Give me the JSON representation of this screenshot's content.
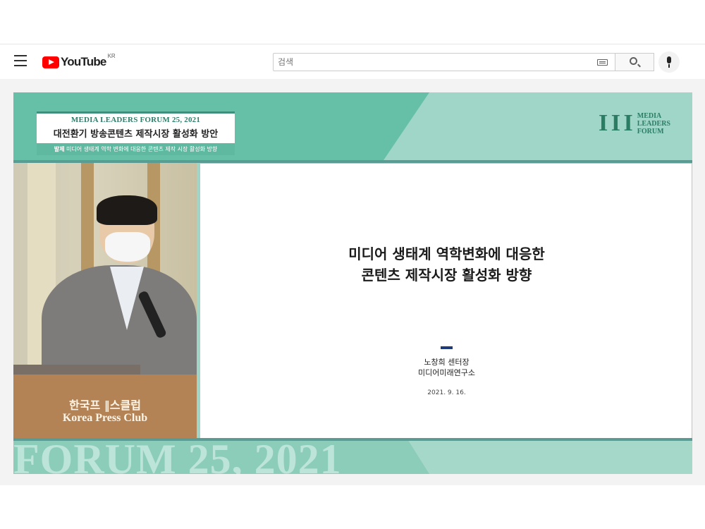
{
  "header": {
    "logo_text": "YouTube",
    "country_code": "KR",
    "search_placeholder": "검색"
  },
  "video": {
    "forum_title_en": "MEDIA LEADERS FORUM 25, 2021",
    "forum_title_ko": "대전환기 방송콘텐츠 제작시장 활성화 방안",
    "subtitle_label": "발제",
    "subtitle_text": "미디어 생태계 역학 변화에 대응한 콘텐츠 제작 시장 활성화 방향",
    "brand_mark": "I I I",
    "brand_line1": "MEDIA",
    "brand_line2": "LEADERS",
    "brand_line3": "FORUM",
    "podium_ko": "한국프 ‖스클럽",
    "podium_en": "Korea Press Club",
    "bottom_watermark": "FORUM 25, 2021"
  },
  "slide": {
    "title_line1": "미디어 생태계 역학변화에 대응한",
    "title_line2": "콘텐츠 제작시장 활성화 방향",
    "author": "노창희 센터장",
    "organization": "미디어미래연구소",
    "date": "2021. 9. 16."
  },
  "colors": {
    "youtube_red": "#ff0000",
    "forum_teal_dark": "#66c0a8",
    "forum_teal_light": "#9fd6c8",
    "brand_green": "#2a7d63",
    "slide_dash": "#1d3a7a"
  },
  "icons": [
    "menu-icon",
    "youtube-play-icon",
    "keyboard-icon",
    "search-icon",
    "mic-icon"
  ]
}
